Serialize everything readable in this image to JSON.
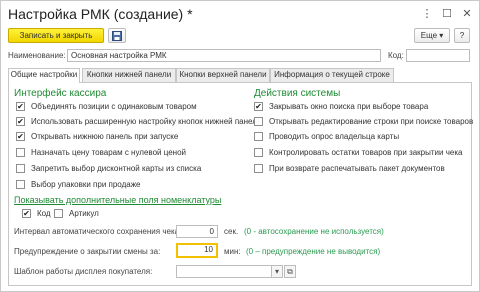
{
  "window": {
    "title": "Настройка РМК (создание) *"
  },
  "toolbar": {
    "save_close_label": "Записать и закрыть",
    "save_icon": "floppy-disk-icon",
    "more_label": "Еще",
    "help_label": "?"
  },
  "header": {
    "name_label": "Наименование:",
    "name_value": "Основная настройка РМК",
    "code_label": "Код:",
    "code_value": ""
  },
  "tabs": [
    {
      "label": "Общие настройки"
    },
    {
      "label": "Кнопки нижней панели"
    },
    {
      "label": "Кнопки верхней панели"
    },
    {
      "label": "Информация о текущей строке"
    }
  ],
  "cashier": {
    "title": "Интерфейс кассира",
    "items": [
      {
        "label": "Объединять позиции с одинаковым товаром",
        "checked": "✔"
      },
      {
        "label": "Использовать расширенную настройку кнопок нижней панели",
        "checked": "✔"
      },
      {
        "label": "Открывать нижнюю панель при запуске",
        "checked": "✔"
      },
      {
        "label": "Назначать цену товарам с нулевой ценой",
        "checked": ""
      },
      {
        "label": "Запретить выбор дисконтной карты из списка",
        "checked": ""
      },
      {
        "label": "Выбор упаковки при продаже",
        "checked": ""
      }
    ]
  },
  "system": {
    "title": "Действия системы",
    "items": [
      {
        "label": "Закрывать окно поиска при выборе товара",
        "checked": "✔"
      },
      {
        "label": "Открывать редактирование строки при поиске товаров",
        "checked": ""
      },
      {
        "label": "Проводить опрос владельца карты",
        "checked": ""
      },
      {
        "label": "Контролировать остатки товаров при закрытии чека",
        "checked": ""
      },
      {
        "label": "При возврате распечатывать пакет документов",
        "checked": ""
      }
    ]
  },
  "extra_fields": {
    "link": "Показывать дополнительные поля номенклатуры",
    "items": [
      {
        "label": "Код",
        "checked": "✔"
      },
      {
        "label": "Артикул",
        "checked": ""
      }
    ]
  },
  "autosave": {
    "label": "Интервал автоматического сохранения чека:",
    "value": "0",
    "unit": "сек.",
    "hint": "(0 - автосохранение не используется)"
  },
  "shift_warning": {
    "label": "Предупреждение о закрытии смены за:",
    "value": "10",
    "unit": "мин:",
    "hint": "(0 – предупреждение не выводится)"
  },
  "display_template": {
    "label": "Шаблон работы дисплея покупателя:",
    "value": "",
    "dropdown_icon": "chevron-down-icon",
    "open_icon": "link-icon"
  }
}
